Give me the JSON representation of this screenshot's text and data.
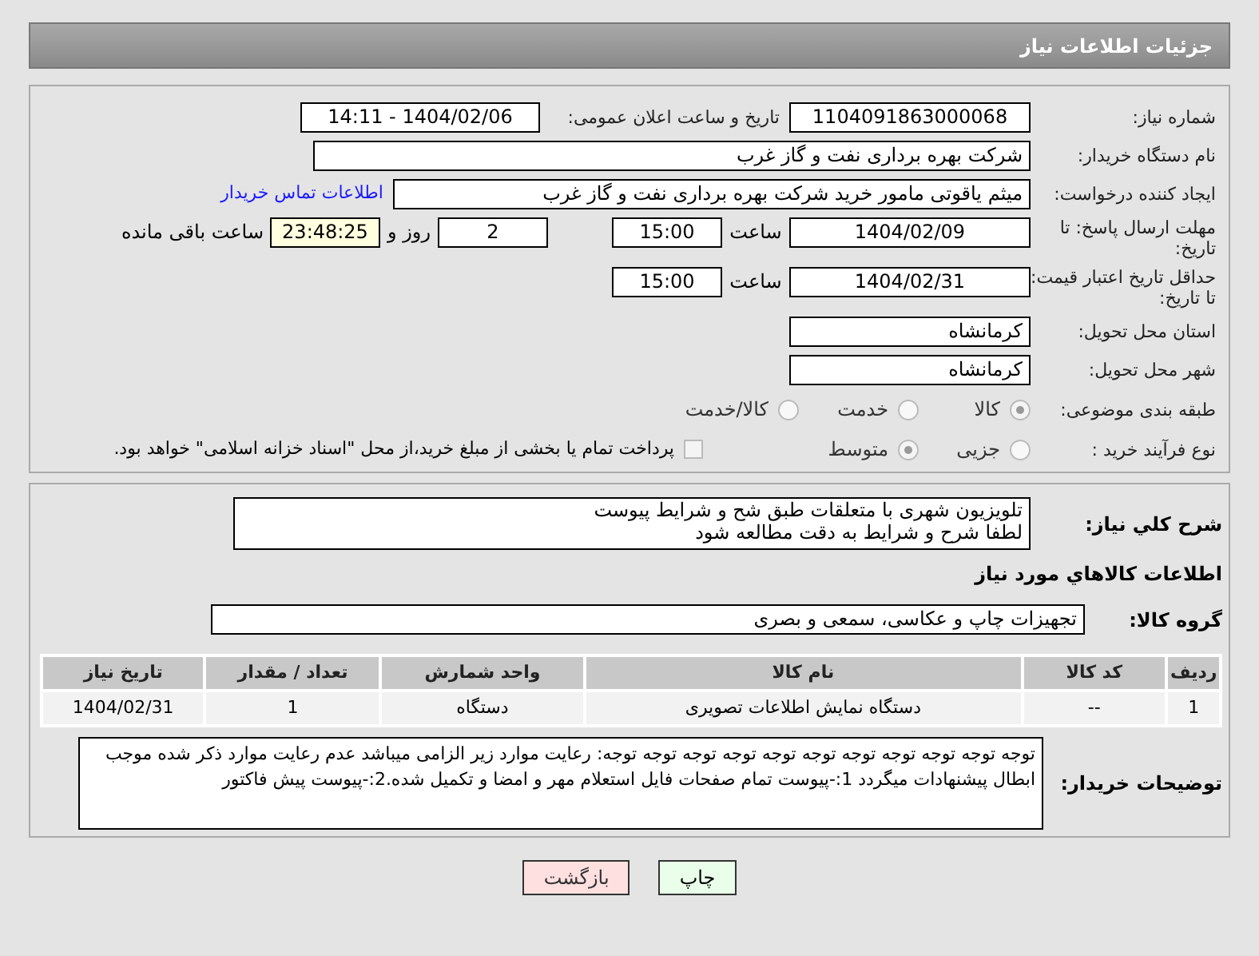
{
  "header": {
    "title": "جزئیات اطلاعات نیاز"
  },
  "details": {
    "need_number": {
      "label": "شماره نیاز:",
      "value": "1104091863000068"
    },
    "announce": {
      "label": "تاریخ و ساعت اعلان عمومی:",
      "value": "1404/02/06 - 14:11"
    },
    "buyer": {
      "label": "نام دستگاه خریدار:",
      "value": "شرکت بهره برداری نفت و گاز غرب"
    },
    "creator": {
      "label": "ایجاد کننده درخواست:",
      "value": "میثم یاقوتی مامور خرید شرکت بهره برداری نفت و گاز غرب",
      "link": "اطلاعات تماس خریدار"
    },
    "reply_deadline": {
      "label": "مهلت ارسال پاسخ: تا تاریخ:",
      "date": "1404/02/09",
      "time_label": "ساعت",
      "time": "15:00",
      "days": "2",
      "days_label": "روز و",
      "remaining": "23:48:25",
      "remaining_label": "ساعت باقی مانده"
    },
    "price_validity": {
      "label": "حداقل تاریخ اعتبار قیمت: تا تاریخ:",
      "date": "1404/02/31",
      "time_label": "ساعت",
      "time": "15:00"
    },
    "province": {
      "label": "استان محل تحویل:",
      "value": "کرمانشاه"
    },
    "city": {
      "label": "شهر محل تحویل:",
      "value": "کرمانشاه"
    },
    "category": {
      "label": "طبقه بندی موضوعی:",
      "options": [
        {
          "label": "کالا",
          "selected": true
        },
        {
          "label": "خدمت",
          "selected": false
        },
        {
          "label": "کالا/خدمت",
          "selected": false
        }
      ]
    },
    "process": {
      "label": "نوع فرآیند خرید :",
      "options": [
        {
          "label": "جزیی",
          "selected": false
        },
        {
          "label": "متوسط",
          "selected": true
        }
      ],
      "treasury": {
        "checked": false,
        "label": "پرداخت تمام یا بخشی از مبلغ خرید،از محل \"اسناد خزانه اسلامی\" خواهد بود."
      }
    }
  },
  "description": {
    "label": "شرح کلي نياز:",
    "lines": [
      "تلویزیون شهری با متعلقات طبق شح و شرایط پیوست",
      "لطفا شرح و شرایط به دقت مطالعه شود"
    ]
  },
  "goods": {
    "title": "اطلاعات کالاهاي مورد نياز",
    "group_label": "گروه کالا:",
    "group": "تجهیزات چاپ و عکاسی، سمعی و بصری",
    "table": {
      "columns": [
        "ردیف",
        "کد کالا",
        "نام کالا",
        "واحد شمارش",
        "تعداد / مقدار",
        "تاریخ نیاز"
      ],
      "rows": [
        [
          "1",
          "--",
          "دستگاه نمایش اطلاعات تصویری",
          "دستگاه",
          "1",
          "1404/02/31"
        ]
      ]
    }
  },
  "buyer_notes": {
    "label": "توضیحات خریدار:",
    "text": "توجه توجه توجه توجه توجه توجه توجه توجه توجه توجه توجه: رعایت موارد زیر الزامی میباشد عدم رعایت موارد ذکر شده موجب ابطال پیشنهادات میگردد 1:-پیوست تمام صفحات  فایل استعلام مهر و امضا و تکمیل شده.2:-پیوست پیش فاکتور"
  },
  "buttons": [
    {
      "label": "چاپ",
      "kind": "print"
    },
    {
      "label": "بازگشت",
      "kind": "back"
    }
  ]
}
